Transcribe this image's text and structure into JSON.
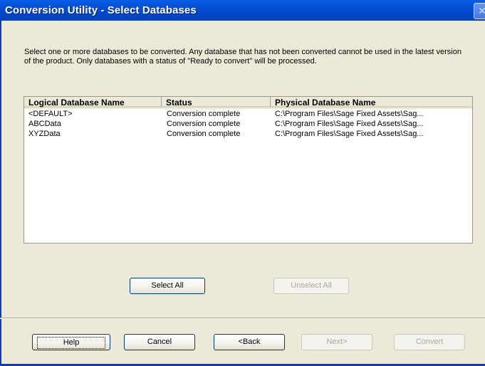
{
  "window": {
    "title": "Conversion Utility - Select Databases",
    "close_glyph": "✕"
  },
  "description": "Select one or more databases to be converted. Any database that has not been converted cannot be used in the latest version of the product. Only databases with a status of \"Ready to convert\" will be processed.",
  "list": {
    "columns": [
      "Logical Database Name",
      "Status",
      "Physical Database Name"
    ],
    "rows": [
      [
        "<DEFAULT>",
        "Conversion complete",
        "C:\\Program Files\\Sage Fixed Assets\\Sag..."
      ],
      [
        "ABCData",
        "Conversion complete",
        "C:\\Program Files\\Sage Fixed Assets\\Sag..."
      ],
      [
        "XYZData",
        "Conversion complete",
        "C:\\Program Files\\Sage Fixed Assets\\Sag..."
      ]
    ]
  },
  "buttons": {
    "select_all": "Select All",
    "unselect_all": "Unselect All",
    "help": "Help",
    "cancel": "Cancel",
    "back": "<Back",
    "next": "Next>",
    "convert": "Convert"
  }
}
